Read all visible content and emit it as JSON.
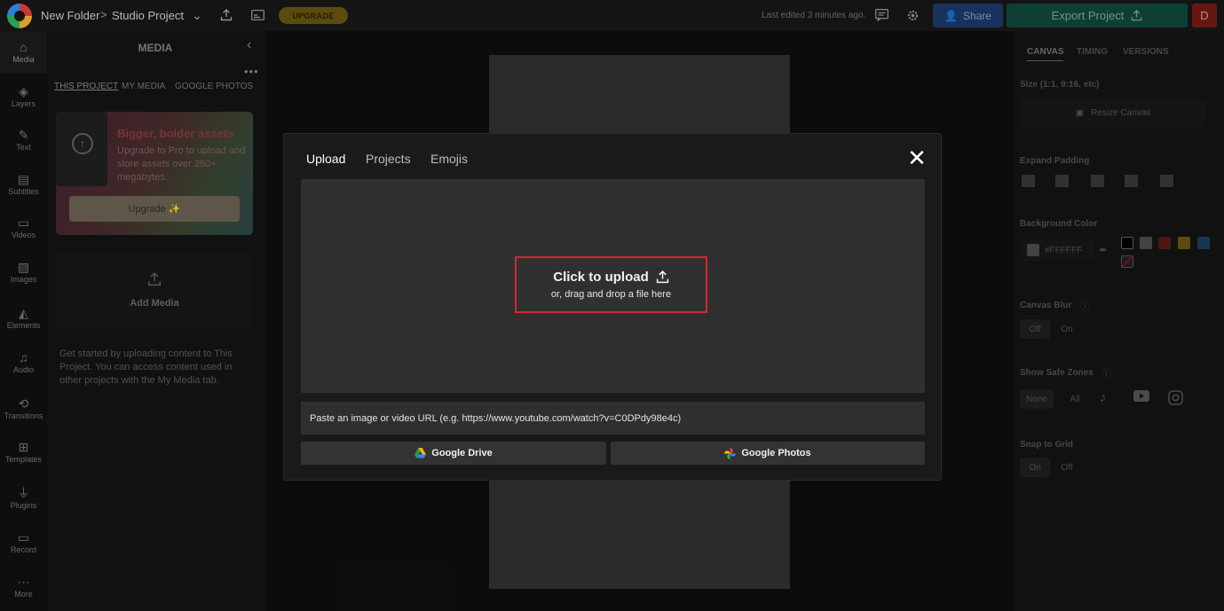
{
  "header": {
    "folder": "New Folder",
    "separator": ">",
    "project": "Studio Project",
    "upgrade_label": "UPGRADE",
    "last_edited": "Last edited 3 minutes ago.",
    "share_label": "Share",
    "export_label": "Export Project",
    "avatar_initial": "D"
  },
  "rail": {
    "items": [
      {
        "label": "Media",
        "icon": "media-icon"
      },
      {
        "label": "Layers",
        "icon": "layers-icon"
      },
      {
        "label": "Text",
        "icon": "text-icon"
      },
      {
        "label": "Subtitles",
        "icon": "subtitles-icon"
      },
      {
        "label": "Videos",
        "icon": "videos-icon"
      },
      {
        "label": "Images",
        "icon": "images-icon"
      },
      {
        "label": "Elements",
        "icon": "elements-icon"
      },
      {
        "label": "Audio",
        "icon": "audio-icon"
      },
      {
        "label": "Transitions",
        "icon": "transitions-icon"
      },
      {
        "label": "Templates",
        "icon": "templates-icon"
      },
      {
        "label": "Plugins",
        "icon": "plugins-icon"
      },
      {
        "label": "Record",
        "icon": "record-icon"
      },
      {
        "label": "More",
        "icon": "more-icon"
      }
    ]
  },
  "media_panel": {
    "title": "MEDIA",
    "tabs": [
      "THIS PROJECT",
      "MY MEDIA",
      "GOOGLE PHOTOS"
    ],
    "promo_title": "Bigger, bolder assets",
    "promo_text": "Upgrade to Pro to upload and store assets over 250+ megabytes.",
    "promo_button": "Upgrade ✨",
    "add_media": "Add Media",
    "help_text": "Get started by uploading content to This Project. You can access content used in other projects with the My Media tab."
  },
  "right_panel": {
    "tabs": [
      "CANVAS",
      "TIMING",
      "VERSIONS"
    ],
    "size_label": "Size (1:1, 9:16, etc)",
    "resize_label": "Resize Canvas",
    "expand_padding_label": "Expand Padding",
    "background_color_label": "Background Color",
    "background_color_value": "#FFFFFF",
    "swatches": [
      "#000000",
      "#4f4f4f",
      "#5a1b16",
      "#6b5a10",
      "#1d3f63"
    ],
    "canvas_blur_label": "Canvas Blur",
    "blur_off": "Off",
    "blur_on": "On",
    "safe_zones_label": "Show Safe Zones",
    "safe_none": "None",
    "safe_all": "All",
    "snap_label": "Snap to Grid",
    "snap_on": "On",
    "snap_off": "Off"
  },
  "modal": {
    "tabs": [
      "Upload",
      "Projects",
      "Emojis"
    ],
    "upload_title": "Click to upload",
    "upload_subtitle": "or, drag and drop a file here",
    "url_placeholder": "Paste an image or video URL (e.g. https://www.youtube.com/watch?v=C0DPdy98e4c)",
    "google_drive": "Google Drive",
    "google_photos": "Google Photos",
    "highlight_color": "#d6262d"
  }
}
